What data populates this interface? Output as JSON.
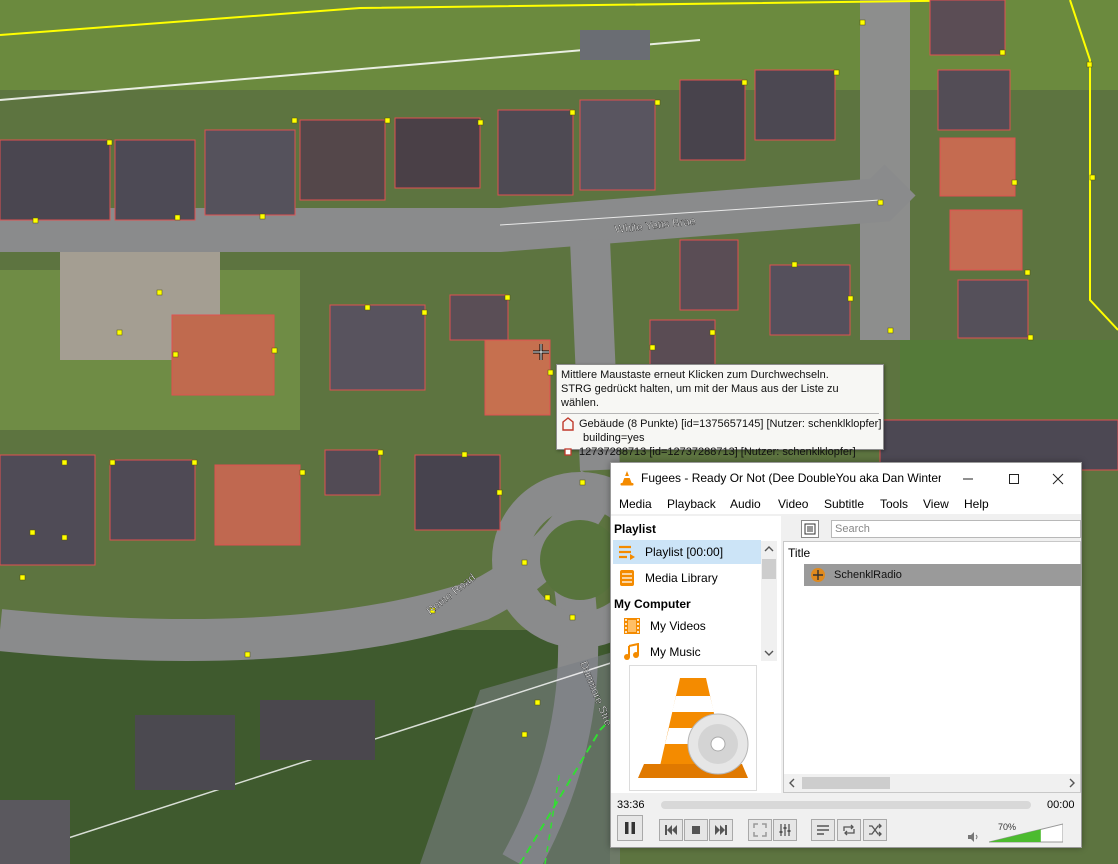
{
  "map": {
    "street_white_yetts": "White Yetts Brae",
    "street_romo": "Romo Road",
    "street_dunmore": "Dunmore Stre"
  },
  "tooltip": {
    "line1": "Mittlere Maustaste erneut Klicken zum Durchwechseln.",
    "line2": "STRG gedrückt halten, um mit der Maus aus der Liste zu wählen.",
    "item1": "Gebäude (8 Punkte) [id=1375657145] [Nutzer: schenklklopfer]",
    "item1_tag": "building=yes",
    "item2": "12737288713 [id=12737288713] [Nutzer: schenklklopfer]"
  },
  "vlc": {
    "title": "Fugees - Ready Or Not (Dee DoubleYou aka Dan Winter ...",
    "menu": [
      "Media",
      "Playback",
      "Audio",
      "Video",
      "Subtitle",
      "Tools",
      "View",
      "Help"
    ],
    "playlist_header": "Playlist",
    "playlist_item": "Playlist [00:00]",
    "media_library": "Media Library",
    "my_computer_header": "My Computer",
    "my_videos": "My Videos",
    "my_music": "My Music",
    "search_placeholder": "Search",
    "column_title": "Title",
    "track": "SchenklRadio",
    "time_elapsed": "33:36",
    "time_total": "00:00",
    "volume": "70%",
    "volume_fraction": 0.7
  },
  "colors": {
    "vlc_orange": "#f48b00",
    "selection": "#cce4f7",
    "osm_yellow": "#ffff00",
    "building_outline": "#e05050"
  }
}
